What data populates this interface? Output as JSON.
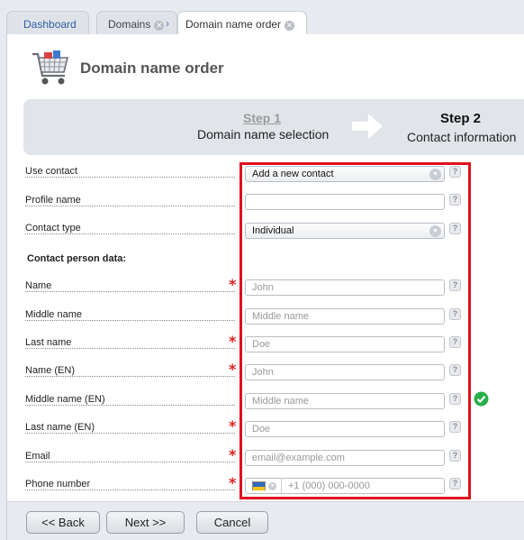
{
  "tabs": [
    {
      "label": "Dashboard"
    },
    {
      "label": "Domains"
    },
    {
      "label": "Domain name order"
    }
  ],
  "tab_separator": "›",
  "tab_close_symbol": "✕",
  "page_title": "Domain name order",
  "steps": {
    "step1": {
      "title": "Step 1",
      "subtitle": "Domain name selection"
    },
    "step2": {
      "title": "Step 2",
      "subtitle": "Contact information"
    }
  },
  "form": {
    "use_contact": {
      "label": "Use contact",
      "value": "Add a new contact"
    },
    "profile_name": {
      "label": "Profile name",
      "value": ""
    },
    "contact_type": {
      "label": "Contact type",
      "value": "Individual"
    },
    "section_heading": "Contact person data:",
    "name": {
      "label": "Name",
      "placeholder": "John",
      "required": true
    },
    "middle_name": {
      "label": "Middle name",
      "placeholder": "Middle name",
      "required": false
    },
    "last_name": {
      "label": "Last name",
      "placeholder": "Doe",
      "required": true
    },
    "name_en": {
      "label": "Name (EN)",
      "placeholder": "John",
      "required": true
    },
    "middle_name_en": {
      "label": "Middle name (EN)",
      "placeholder": "Middle name",
      "required": false,
      "validated": true
    },
    "last_name_en": {
      "label": "Last name (EN)",
      "placeholder": "Doe",
      "required": true
    },
    "email": {
      "label": "Email",
      "placeholder": "email@example.com",
      "required": true
    },
    "phone": {
      "label": "Phone number",
      "placeholder": "+1 (000) 000-0000",
      "required": true
    }
  },
  "help_symbol": "?",
  "required_symbol": "*",
  "buttons": {
    "back": "<< Back",
    "next": "Next >>",
    "cancel": "Cancel"
  },
  "colors": {
    "required": "#e02020",
    "highlight_frame": "#e0101f",
    "valid": "#2ab04a",
    "link": "#2f5fa0"
  },
  "icons": [
    "shopping-cart-icon",
    "close-icon",
    "chevron-down-icon",
    "help-icon",
    "check-circle-icon",
    "ukraine-flag-icon",
    "arrow-right-icon"
  ]
}
